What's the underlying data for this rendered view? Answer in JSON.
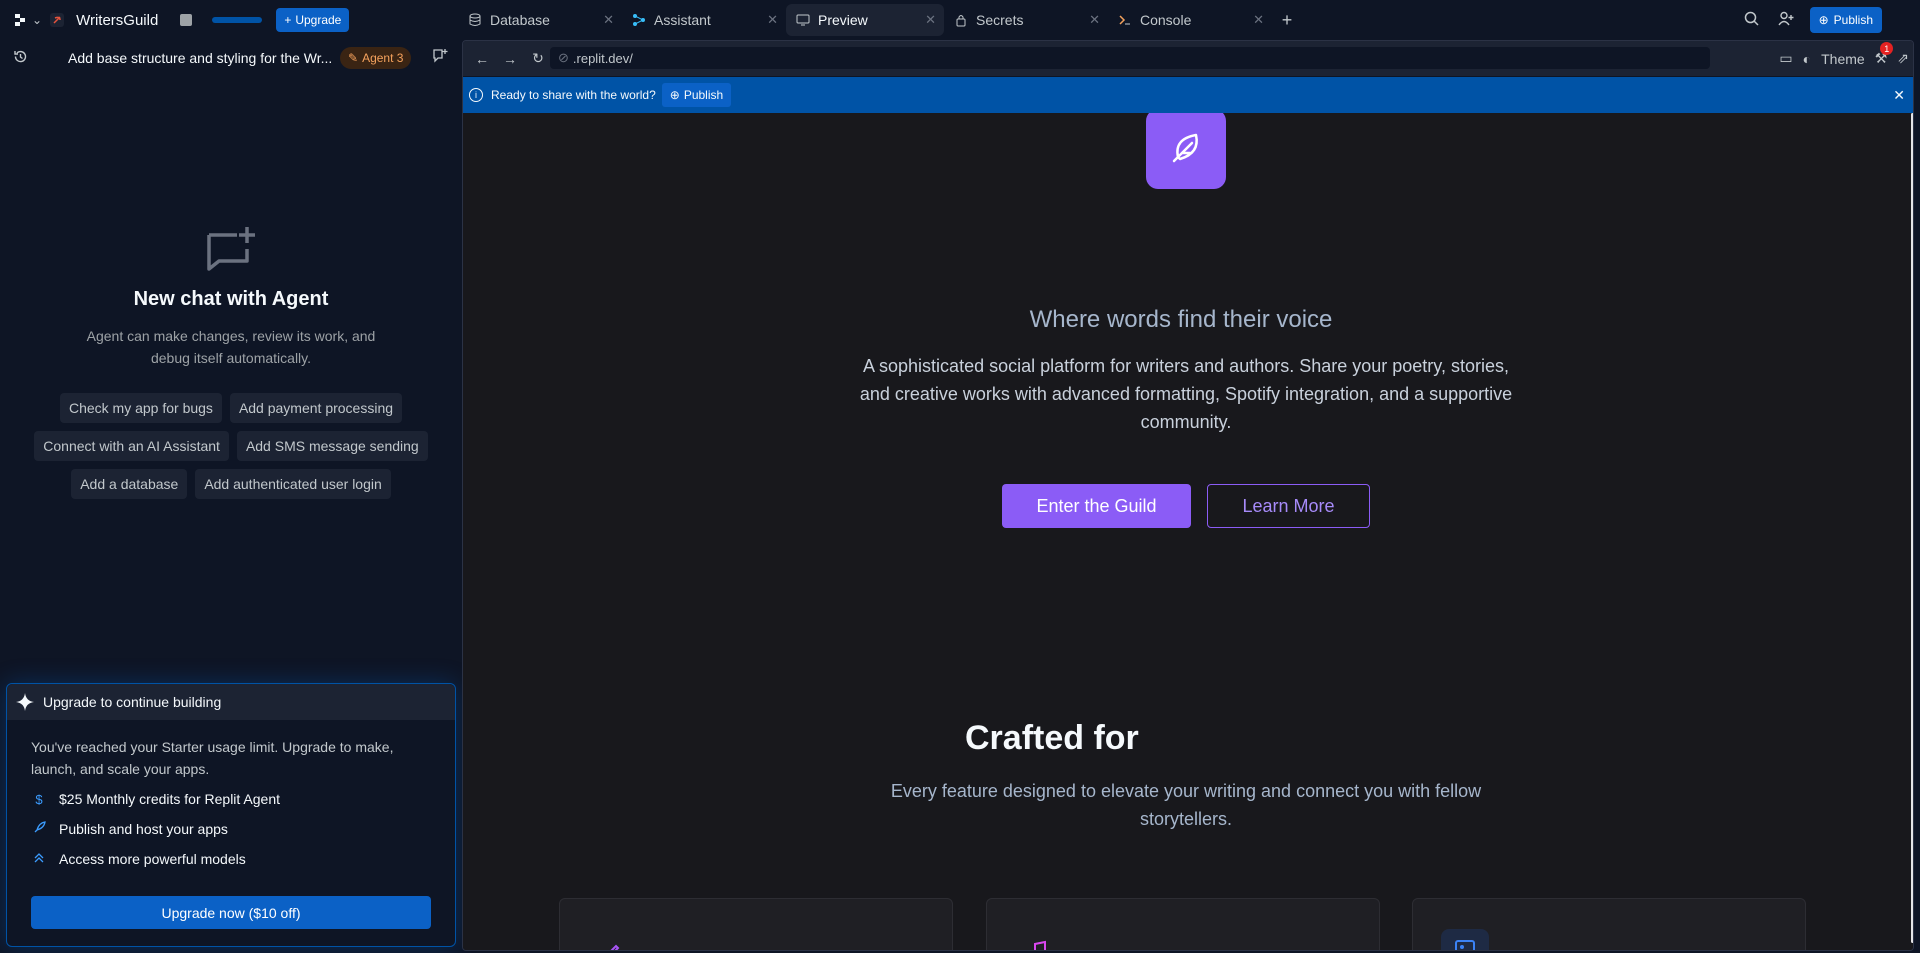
{
  "topbar": {
    "project_name": "WritersGuild",
    "upgrade_label": "Upgrade",
    "publish_label": "Publish",
    "tabs": [
      {
        "label": "Database",
        "icon": "database-icon"
      },
      {
        "label": "Assistant",
        "icon": "assistant-icon"
      },
      {
        "label": "Preview",
        "icon": "monitor-icon",
        "active": true
      },
      {
        "label": "Secrets",
        "icon": "lock-icon"
      },
      {
        "label": "Console",
        "icon": "terminal-icon"
      }
    ]
  },
  "chat": {
    "title": "Add base structure and styling for the Wr...",
    "agent_badge": "Agent 3",
    "empty_title": "New chat with Agent",
    "empty_desc": "Agent can make changes, review its work, and debug itself automatically.",
    "suggestions": [
      [
        "Check my app for bugs",
        "Add payment processing"
      ],
      [
        "Connect with an AI Assistant",
        "Add SMS message sending"
      ],
      [
        "Add a database",
        "Add authenticated user login"
      ]
    ]
  },
  "upgrade_card": {
    "title": "Upgrade to continue building",
    "desc": "You've reached your Starter usage limit. Upgrade to make, launch, and scale your apps.",
    "features": [
      {
        "icon": "dollar-icon",
        "text": "$25 Monthly credits for Replit Agent"
      },
      {
        "icon": "rocket-icon",
        "text": "Publish and host your apps"
      },
      {
        "icon": "chevrons-up-icon",
        "text": "Access more powerful models"
      }
    ],
    "button": "Upgrade now ($10 off)"
  },
  "preview": {
    "url": ".replit.dev/",
    "theme_label": "Theme",
    "notif_count": "1",
    "banner_text": "Ready to share with the world?",
    "banner_button": "Publish"
  },
  "site": {
    "tagline": "Where words find their voice",
    "description": "A sophisticated social platform for writers and authors. Share your poetry, stories, and creative works with advanced formatting, Spotify integration, and a supportive community.",
    "cta_primary": "Enter the Guild",
    "cta_secondary": "Learn More",
    "section_title": "Crafted for",
    "section_sub": "Every feature designed to elevate your writing and connect you with fellow storytellers.",
    "colors": {
      "accent": "#8b5cf6",
      "replit_blue": "#0b61c6"
    }
  }
}
